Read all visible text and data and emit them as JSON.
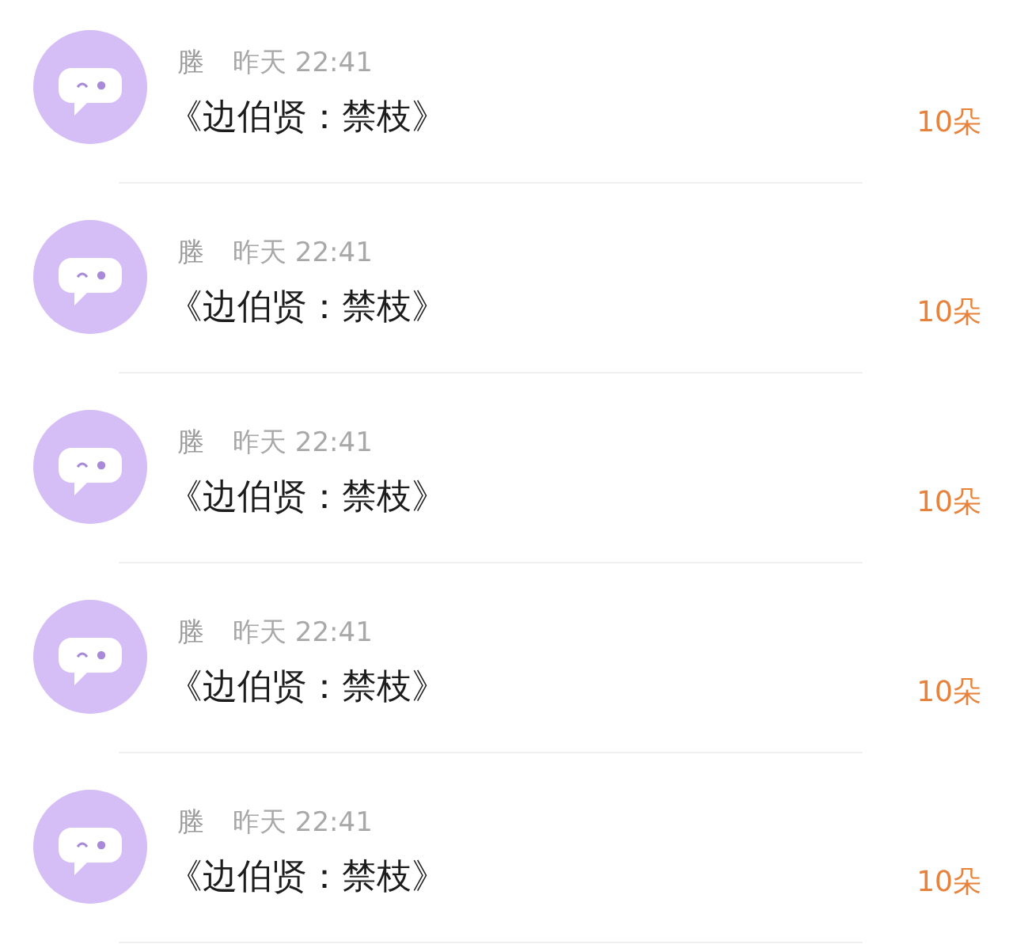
{
  "items": [
    {
      "name": "塍",
      "time": "昨天 22:41",
      "title": "《边伯贤：禁枝》",
      "amount": "10朵"
    },
    {
      "name": "塍",
      "time": "昨天 22:41",
      "title": "《边伯贤：禁枝》",
      "amount": "10朵"
    },
    {
      "name": "塍",
      "time": "昨天 22:41",
      "title": "《边伯贤：禁枝》",
      "amount": "10朵"
    },
    {
      "name": "塍",
      "time": "昨天 22:41",
      "title": "《边伯贤：禁枝》",
      "amount": "10朵"
    },
    {
      "name": "塍",
      "time": "昨天 22:41",
      "title": "《边伯贤：禁枝》",
      "amount": "10朵"
    }
  ]
}
